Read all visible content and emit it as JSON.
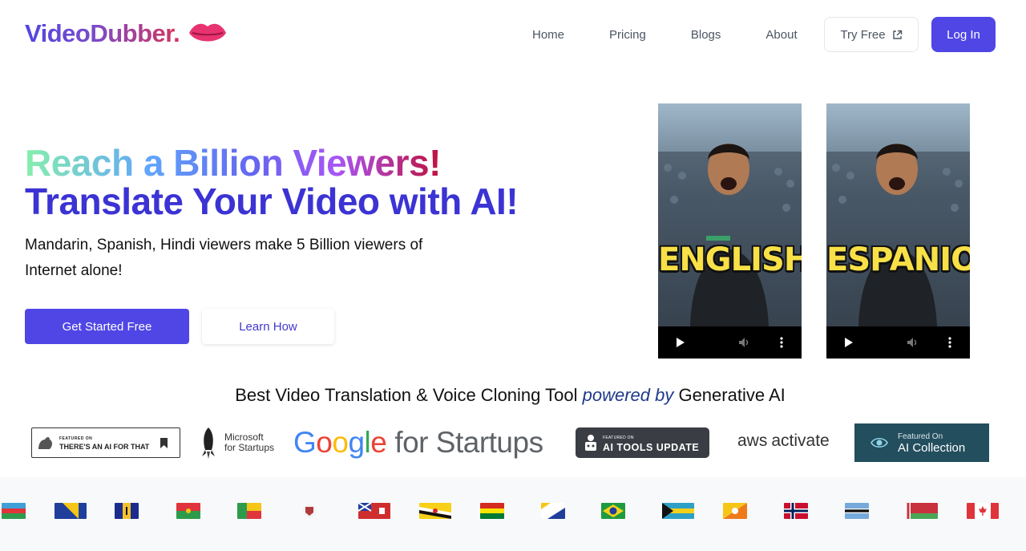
{
  "brand": {
    "name": "VideoDubber.",
    "accent": "#4f46e5"
  },
  "nav": {
    "links": [
      "Home",
      "Pricing",
      "Blogs",
      "About"
    ],
    "try_free": "Try Free",
    "login": "Log In"
  },
  "hero": {
    "title_line1": "Reach a Billion Viewers!",
    "title_line2": "Translate Your Video with AI!",
    "subtitle": "Mandarin, Spanish, Hindi viewers make 5 Billion viewers of Internet alone!",
    "primary_cta": "Get Started Free",
    "secondary_cta": "Learn How"
  },
  "videos": [
    {
      "caption": "ENGLISH",
      "controls": [
        "play-icon",
        "volume-icon",
        "more-icon"
      ]
    },
    {
      "caption": "ESPANIOL",
      "controls": [
        "play-icon",
        "volume-icon",
        "more-icon"
      ]
    }
  ],
  "tagline": {
    "before": "Best Video Translation & Voice Cloning Tool ",
    "emphasis": "powered by",
    "after": " Generative AI"
  },
  "badges": {
    "aiforthat": {
      "small": "FEATURED ON",
      "text": "THERE'S AN AI FOR THAT"
    },
    "microsoft": {
      "line1": "Microsoft",
      "line2": "for Startups"
    },
    "google": {
      "g": "Google",
      "rest": "for Startups"
    },
    "aitools": {
      "small": "FEATURED ON",
      "text": "AI TOOLS UPDATE"
    },
    "aws": {
      "aws": "aws",
      "rest": "activate"
    },
    "aicollection": {
      "small": "Featured On",
      "text": "AI Collection"
    }
  },
  "flags": [
    "azerbaijan-flag",
    "bosnia-flag",
    "barbados-flag",
    "burkina-faso-flag",
    "benin-flag",
    "bermuda-crest-flag",
    "bermuda-flag",
    "brunei-flag",
    "bolivia-flag",
    "bonaire-flag",
    "brazil-flag",
    "bahamas-flag",
    "bhutan-flag",
    "norway-flag",
    "botswana-flag",
    "belarus-flag",
    "canada-flag"
  ]
}
